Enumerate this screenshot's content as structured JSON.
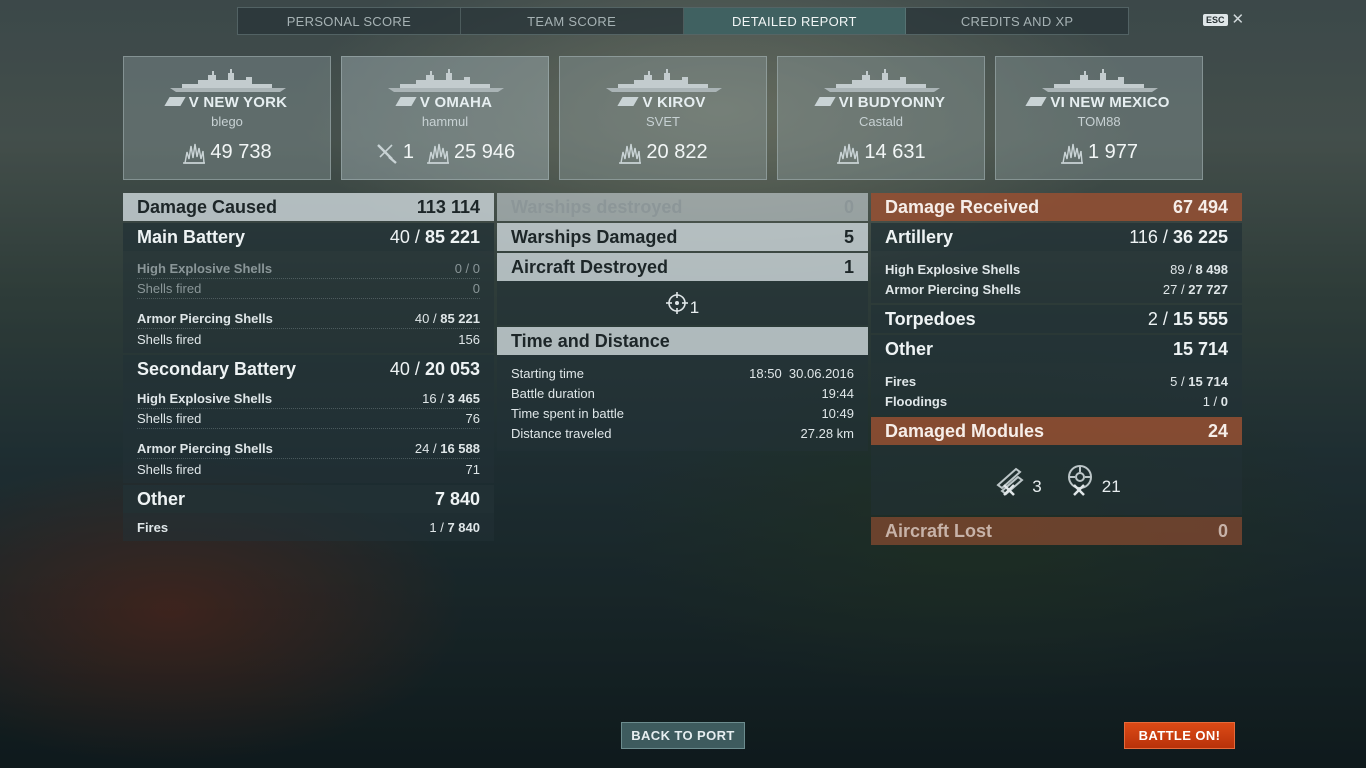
{
  "tabs": {
    "personal_score": "PERSONAL SCORE",
    "team_score": "TEAM SCORE",
    "detailed_report": "DETAILED REPORT",
    "credits_xp": "CREDITS AND XP",
    "active": "DETAILED REPORT"
  },
  "esc_label": "ESC",
  "ships": [
    {
      "name": "V NEW YORK",
      "player": "blego",
      "damage": "49 738",
      "selected": false
    },
    {
      "name": "V OMAHA",
      "player": "hammul",
      "kills": "1",
      "damage": "25 946",
      "selected": true
    },
    {
      "name": "V KIROV",
      "player": "SVET",
      "damage": "20 822",
      "selected": false
    },
    {
      "name": "VI BUDYONNY",
      "player": "Castald",
      "damage": "14 631",
      "selected": false
    },
    {
      "name": "VI NEW MEXICO",
      "player": "TOM88",
      "damage": "1 977",
      "selected": false
    }
  ],
  "damage_caused": {
    "title": "Damage Caused",
    "value": "113 114",
    "main_battery": {
      "title": "Main Battery",
      "hits": "40",
      "damage": "85 221",
      "he_label": "High Explosive Shells",
      "he_value": "0 / 0",
      "he_fired_label": "Shells fired",
      "he_fired": "0",
      "ap_label": "Armor Piercing Shells",
      "ap_hits": "40",
      "ap_damage": "85 221",
      "ap_fired_label": "Shells fired",
      "ap_fired": "156"
    },
    "secondary": {
      "title": "Secondary Battery",
      "hits": "40",
      "damage": "20 053",
      "he_label": "High Explosive Shells",
      "he_hits": "16",
      "he_damage": "3 465",
      "he_fired_label": "Shells fired",
      "he_fired": "76",
      "ap_label": "Armor Piercing Shells",
      "ap_hits": "24",
      "ap_damage": "16 588",
      "ap_fired_label": "Shells fired",
      "ap_fired": "71"
    },
    "other": {
      "title": "Other",
      "value": "7 840",
      "fires_label": "Fires",
      "fires_count": "1",
      "fires_damage": "7 840"
    }
  },
  "center": {
    "warships_destroyed": {
      "label": "Warships destroyed",
      "value": "0"
    },
    "warships_damaged": {
      "label": "Warships Damaged",
      "value": "5"
    },
    "aircraft_destroyed": {
      "label": "Aircraft Destroyed",
      "value": "1"
    },
    "spotted_count": "1",
    "time_distance": {
      "title": "Time and Distance",
      "starting_label": "Starting time",
      "starting_value": "18:50  30.06.2016",
      "duration_label": "Battle duration",
      "duration_value": "19:44",
      "spent_label": "Time spent in battle",
      "spent_value": "10:49",
      "distance_label": "Distance traveled",
      "distance_value": "27.28 km"
    }
  },
  "damage_received": {
    "title": "Damage Received",
    "value": "67 494",
    "artillery": {
      "title": "Artillery",
      "hits": "116",
      "damage": "36 225",
      "he_label": "High Explosive Shells",
      "he_hits": "89",
      "he_damage": "8 498",
      "ap_label": "Armor Piercing Shells",
      "ap_hits": "27",
      "ap_damage": "27 727"
    },
    "torpedoes": {
      "title": "Torpedoes",
      "hits": "2",
      "damage": "15 555"
    },
    "other": {
      "title": "Other",
      "value": "15 714",
      "fires_label": "Fires",
      "fires_count": "5",
      "fires_damage": "15 714",
      "flood_label": "Floodings",
      "flood_count": "1",
      "flood_damage": "0"
    },
    "modules": {
      "title": "Damaged Modules",
      "value": "24",
      "mod1_count": "3",
      "mod2_count": "21"
    },
    "aircraft_lost": {
      "label": "Aircraft Lost",
      "value": "0"
    }
  },
  "buttons": {
    "back_to_port": "BACK TO PORT",
    "battle_on": "BATTLE ON!"
  },
  "colors": {
    "accent_orange": "#dc4a16",
    "received_header": "#965032",
    "active_tab": "#466e6e"
  }
}
